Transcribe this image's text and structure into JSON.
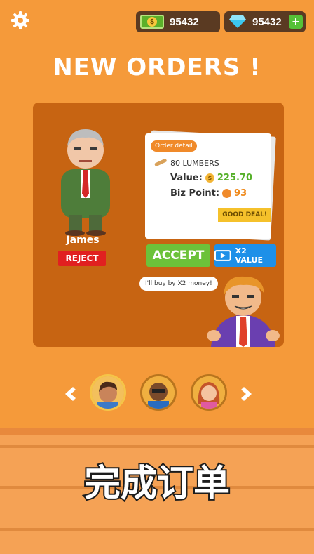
{
  "top_bar": {
    "cash_value": "95432",
    "gem_value": "95432"
  },
  "headline": "NEW ORDERS !",
  "order": {
    "customer_name": "James",
    "reject_label": "REJECT",
    "detail_tag": "Order detail",
    "item": "80 LUMBERS",
    "value_label": "Value:",
    "value_amount": "225.70",
    "biz_label": "Biz Point:",
    "biz_amount": "93",
    "good_deal": "GOOD DEAL!",
    "accept_label": "ACCEPT",
    "x2_label": "X2 VALUE",
    "speech": "I'll buy by X2 money!"
  },
  "caption": "完成订单",
  "colors": {
    "background": "#F59A3A",
    "panel": "#C76412",
    "accept": "#6CC23A",
    "x2": "#1E90E8",
    "reject": "#E12020"
  }
}
